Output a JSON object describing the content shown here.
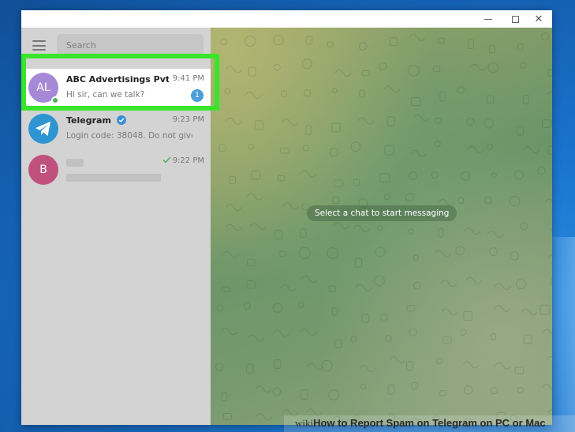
{
  "window": {
    "controls": {
      "minimize": "",
      "maximize": "",
      "close": "✕"
    }
  },
  "sidebar": {
    "search_placeholder": "Search",
    "chats": [
      {
        "initials": "AL",
        "name": "ABC Advertisings Pvt. L...",
        "time": "9:41 PM",
        "preview": "Hi sir, can we talk?",
        "unread": "1",
        "avatar_color": "#a689d6",
        "online": true,
        "selected": true
      },
      {
        "icon": "telegram-logo-icon",
        "name": "Telegram",
        "verified": true,
        "time": "9:23 PM",
        "preview": "Login code: 38048. Do not give t...",
        "avatar_color": "#2f95d2"
      },
      {
        "initials": "B",
        "time": "9:22 PM",
        "read_status": "check-icon",
        "avatar_color": "#c0517f",
        "name_blurred": true,
        "preview_blurred": true
      }
    ]
  },
  "main": {
    "empty_state": "Select a chat to start messaging"
  },
  "highlight": {
    "color": "#39e52b"
  },
  "watermark": {
    "brand": "wiki",
    "text": "How to Report Spam on Telegram on PC or Mac"
  },
  "colors": {
    "desktop": "#1a74cd",
    "sidebar": "#d3d3d3",
    "badge": "#4a9fd8"
  }
}
